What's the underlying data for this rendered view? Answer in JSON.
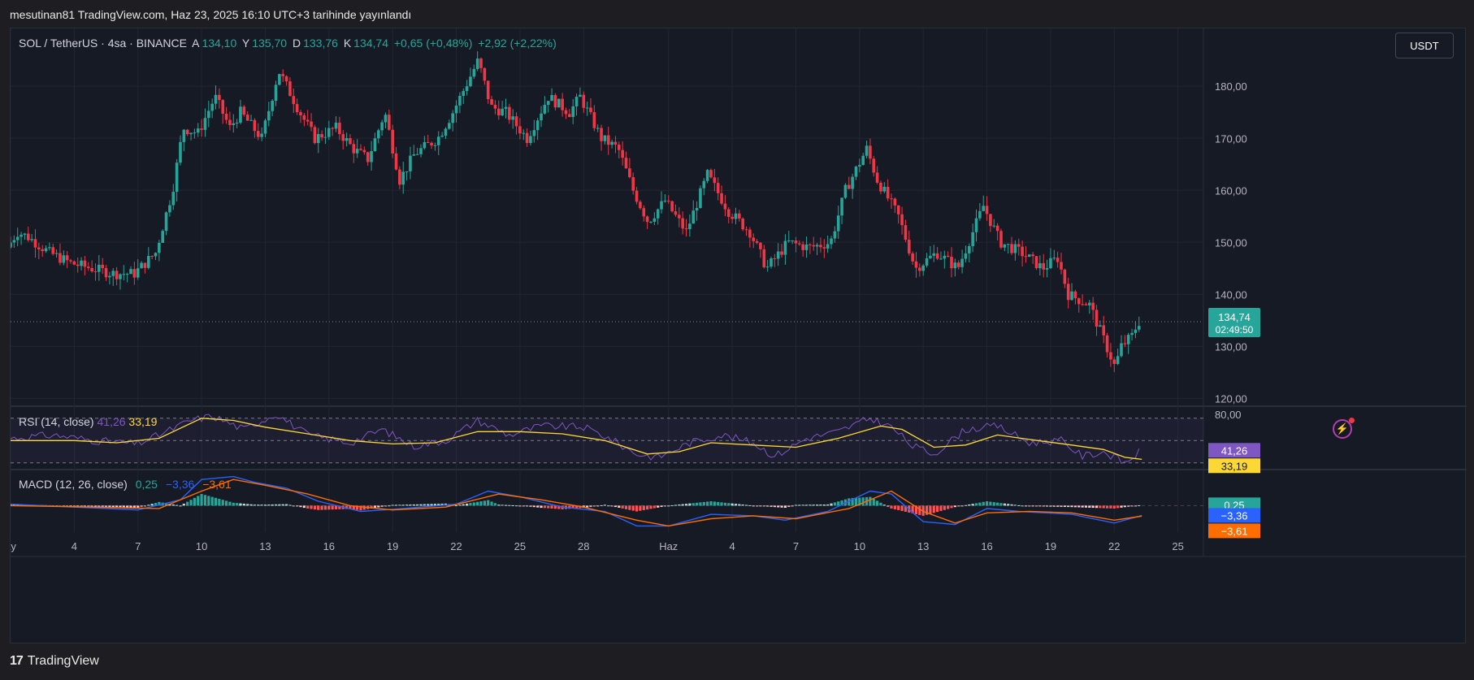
{
  "caption": "mesutinan81 TradingView.com, Haz 23, 2025 16:10 UTC+3 tarihinde yayınlandı",
  "legend": {
    "symbol": "SOL / TetherUS · 4sa · BINANCE",
    "open_label": "A",
    "open": "134,10",
    "high_label": "Y",
    "high": "135,70",
    "low_label": "D",
    "low": "133,76",
    "close_label": "K",
    "close": "134,74",
    "change": "+0,65 (+0,48%)",
    "change2": "+2,92 (+2,22%)"
  },
  "currency_button": "USDT",
  "price_badge": {
    "price": "134,74",
    "countdown": "02:49:50"
  },
  "rsi": {
    "title": "RSI (14, close)",
    "rsi_value": "41,26",
    "ma_value": "33,19",
    "axis_top": "80,00"
  },
  "macd": {
    "title": "MACD (12, 26, close)",
    "hist": "0,25",
    "macd": "−3,36",
    "signal": "−3,61"
  },
  "footer": {
    "brand": "TradingView",
    "logo": "17"
  },
  "colors": {
    "up": "#26a69a",
    "down": "#f23645",
    "rsi": "#7e57c2",
    "rsi_ma": "#fdd835",
    "macd": "#2962ff",
    "signal": "#ff6d00",
    "bg": "#161a25",
    "grid": "#22262f"
  },
  "chart_data": {
    "type": "candlestick",
    "interval": "4h",
    "y_ticks": [
      "120,00",
      "130,00",
      "140,00",
      "150,00",
      "160,00",
      "170,00",
      "180,00"
    ],
    "y_tick_values": [
      120,
      130,
      140,
      150,
      160,
      170,
      180
    ],
    "ylim": [
      118.5,
      188
    ],
    "x_ticks": [
      "ay",
      "4",
      "7",
      "10",
      "13",
      "16",
      "19",
      "22",
      "25",
      "28",
      "Haz",
      "4",
      "7",
      "10",
      "13",
      "16",
      "19",
      "22",
      "25"
    ],
    "x_tick_days": [
      1,
      4,
      7,
      10,
      13,
      16,
      19,
      22,
      25,
      28,
      32,
      35,
      38,
      41,
      44,
      47,
      50,
      53,
      56
    ],
    "xlim_days": [
      1,
      57.2
    ],
    "price_path": [
      [
        1,
        149
      ],
      [
        1.5,
        152
      ],
      [
        2,
        151
      ],
      [
        3,
        148
      ],
      [
        4,
        146
      ],
      [
        5,
        145
      ],
      [
        6,
        144
      ],
      [
        7,
        144
      ],
      [
        8,
        148
      ],
      [
        8.8,
        160
      ],
      [
        9.3,
        172
      ],
      [
        10,
        171
      ],
      [
        10.8,
        178
      ],
      [
        11.5,
        172
      ],
      [
        12,
        175
      ],
      [
        13,
        170
      ],
      [
        13.8,
        183
      ],
      [
        14.8,
        175
      ],
      [
        15.5,
        170
      ],
      [
        16.5,
        172
      ],
      [
        17.3,
        168
      ],
      [
        18,
        166
      ],
      [
        18.8,
        175
      ],
      [
        19.5,
        162
      ],
      [
        20.2,
        167
      ],
      [
        21.3,
        170
      ],
      [
        22,
        175
      ],
      [
        22.6,
        180
      ],
      [
        23.2,
        185
      ],
      [
        23.8,
        176
      ],
      [
        24.5,
        175
      ],
      [
        25.5,
        170
      ],
      [
        26.5,
        178
      ],
      [
        27.5,
        175
      ],
      [
        28,
        178
      ],
      [
        29,
        170
      ],
      [
        29.8,
        168
      ],
      [
        30.5,
        160
      ],
      [
        31.2,
        154
      ],
      [
        32,
        158
      ],
      [
        33,
        152
      ],
      [
        34,
        163
      ],
      [
        35,
        156
      ],
      [
        36,
        152
      ],
      [
        36.8,
        145
      ],
      [
        37.8,
        150
      ],
      [
        38.8,
        149
      ],
      [
        39.8,
        150
      ],
      [
        40.5,
        160
      ],
      [
        41.5,
        168
      ],
      [
        42,
        162
      ],
      [
        43,
        155
      ],
      [
        43.8,
        145
      ],
      [
        44.8,
        148
      ],
      [
        45.8,
        145
      ],
      [
        46.5,
        152
      ],
      [
        47,
        157
      ],
      [
        47.8,
        150
      ],
      [
        48.8,
        148
      ],
      [
        49.8,
        145
      ],
      [
        50.5,
        147
      ],
      [
        51,
        140
      ],
      [
        52,
        138
      ],
      [
        52.8,
        130
      ],
      [
        53.2,
        126
      ],
      [
        53.5,
        130
      ],
      [
        54,
        132
      ],
      [
        54.3,
        134.74
      ]
    ],
    "last_price": 134.74,
    "rsi_series": [
      [
        1,
        52
      ],
      [
        3,
        55
      ],
      [
        5,
        50
      ],
      [
        7,
        47
      ],
      [
        8,
        55
      ],
      [
        9.5,
        68
      ],
      [
        10.5,
        72
      ],
      [
        12,
        60
      ],
      [
        13.5,
        74
      ],
      [
        15,
        55
      ],
      [
        17,
        48
      ],
      [
        18.5,
        60
      ],
      [
        20,
        45
      ],
      [
        21.5,
        50
      ],
      [
        23,
        68
      ],
      [
        24.5,
        55
      ],
      [
        26,
        63
      ],
      [
        28,
        62
      ],
      [
        29,
        54
      ],
      [
        30.5,
        38
      ],
      [
        31.5,
        35
      ],
      [
        33,
        48
      ],
      [
        34.5,
        55
      ],
      [
        36,
        48
      ],
      [
        37,
        36
      ],
      [
        38.5,
        52
      ],
      [
        40,
        58
      ],
      [
        41.5,
        70
      ],
      [
        42.5,
        62
      ],
      [
        43.5,
        45
      ],
      [
        44.5,
        38
      ],
      [
        46,
        60
      ],
      [
        47.5,
        63
      ],
      [
        49,
        48
      ],
      [
        50.5,
        50
      ],
      [
        51.5,
        36
      ],
      [
        52.5,
        40
      ],
      [
        53.5,
        30
      ],
      [
        54.3,
        41.26
      ]
    ],
    "rsi_ma_series": [
      [
        1,
        50
      ],
      [
        4,
        50
      ],
      [
        6,
        48
      ],
      [
        8,
        52
      ],
      [
        10,
        70
      ],
      [
        11.5,
        68
      ],
      [
        13,
        62
      ],
      [
        15,
        56
      ],
      [
        17,
        50
      ],
      [
        19,
        47
      ],
      [
        21,
        48
      ],
      [
        23,
        58
      ],
      [
        25,
        58
      ],
      [
        27,
        56
      ],
      [
        29,
        50
      ],
      [
        31,
        38
      ],
      [
        32.5,
        40
      ],
      [
        34,
        48
      ],
      [
        36,
        46
      ],
      [
        38,
        44
      ],
      [
        40,
        52
      ],
      [
        42,
        63
      ],
      [
        43,
        60
      ],
      [
        44.5,
        44
      ],
      [
        46,
        46
      ],
      [
        47.5,
        55
      ],
      [
        49,
        51
      ],
      [
        51,
        46
      ],
      [
        52.5,
        42
      ],
      [
        53.5,
        35
      ],
      [
        54.3,
        33.19
      ]
    ],
    "rsi_levels": [
      70,
      50,
      30
    ],
    "rsi_range": [
      24,
      80
    ],
    "macd_series": [
      [
        1,
        0.5
      ],
      [
        4,
        -0.5
      ],
      [
        7,
        -1.5
      ],
      [
        9,
        2
      ],
      [
        10,
        9
      ],
      [
        11.5,
        10
      ],
      [
        12.5,
        8
      ],
      [
        14,
        6
      ],
      [
        15.5,
        1.5
      ],
      [
        17.5,
        -2
      ],
      [
        19.5,
        -1
      ],
      [
        22,
        0.5
      ],
      [
        23.5,
        5
      ],
      [
        25,
        3
      ],
      [
        27,
        -0.5
      ],
      [
        29,
        -2
      ],
      [
        30.5,
        -7
      ],
      [
        32,
        -7
      ],
      [
        34,
        -3
      ],
      [
        36,
        -3.5
      ],
      [
        37.5,
        -5
      ],
      [
        39.5,
        -2
      ],
      [
        41.5,
        5
      ],
      [
        42.5,
        4
      ],
      [
        44,
        -5.5
      ],
      [
        45.5,
        -6.5
      ],
      [
        47,
        -1
      ],
      [
        48.5,
        -2
      ],
      [
        51,
        -3
      ],
      [
        53,
        -6
      ],
      [
        54.3,
        -3.36
      ]
    ],
    "signal_series": [
      [
        1,
        0
      ],
      [
        5,
        -0.5
      ],
      [
        8,
        -1
      ],
      [
        10,
        5
      ],
      [
        11.5,
        9
      ],
      [
        13,
        7
      ],
      [
        15,
        4
      ],
      [
        17,
        0
      ],
      [
        19,
        -1.5
      ],
      [
        21.5,
        -0.5
      ],
      [
        24,
        4
      ],
      [
        26,
        2
      ],
      [
        28,
        -0.5
      ],
      [
        30.5,
        -5
      ],
      [
        32,
        -7
      ],
      [
        34,
        -4.5
      ],
      [
        36,
        -3.5
      ],
      [
        38,
        -4.5
      ],
      [
        40.5,
        -1
      ],
      [
        42.5,
        5
      ],
      [
        44,
        -2
      ],
      [
        45.5,
        -6
      ],
      [
        47,
        -2.5
      ],
      [
        49,
        -2
      ],
      [
        51,
        -2.5
      ],
      [
        53,
        -5
      ],
      [
        54.3,
        -3.61
      ]
    ],
    "macd_range": [
      -8,
      11
    ]
  }
}
